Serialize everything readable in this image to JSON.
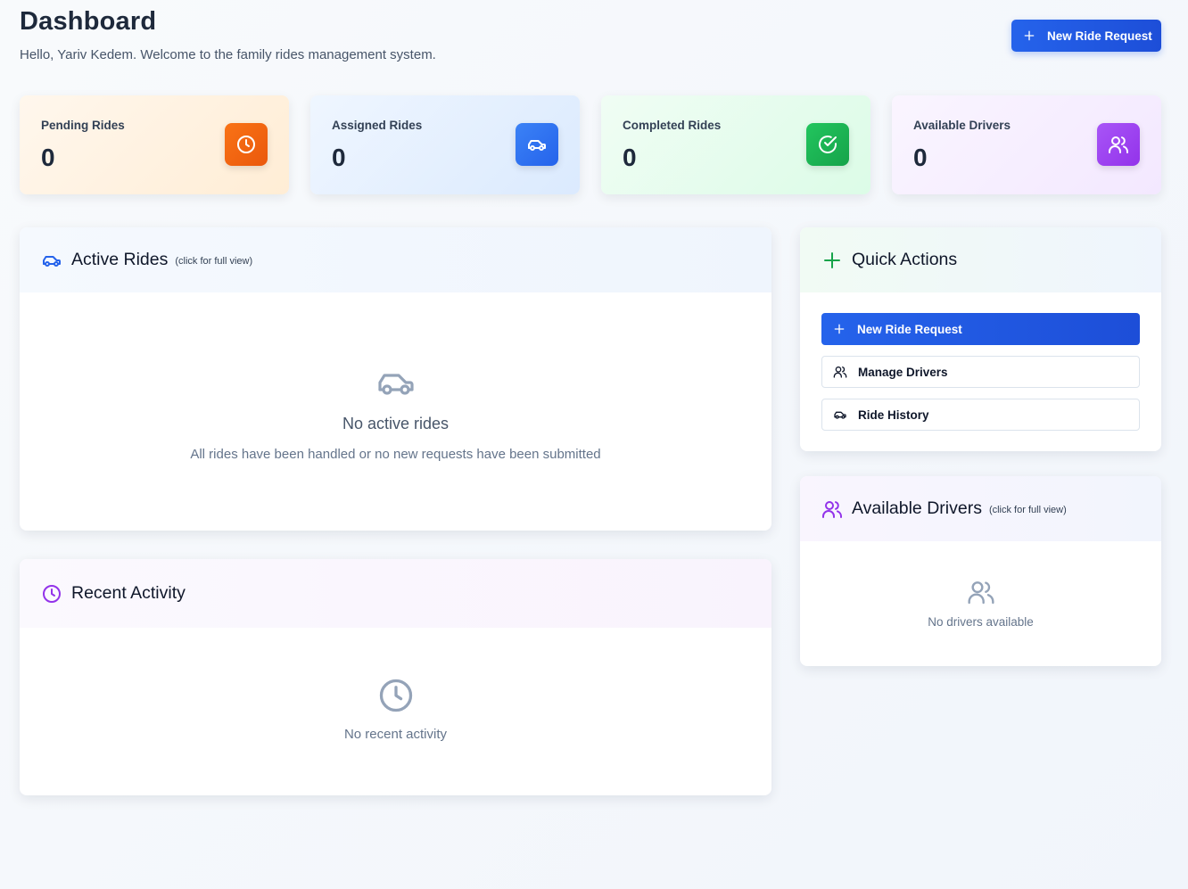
{
  "header": {
    "title": "Dashboard",
    "subtitle": "Hello, Yariv Kedem. Welcome to the family rides management system.",
    "new_ride_label": "New Ride Request"
  },
  "stats": [
    {
      "label": "Pending Rides",
      "value": "0",
      "icon": "clock-icon",
      "color": "#f97316"
    },
    {
      "label": "Assigned Rides",
      "value": "0",
      "icon": "car-icon",
      "color": "#2563eb"
    },
    {
      "label": "Completed Rides",
      "value": "0",
      "icon": "check-circle-icon",
      "color": "#16a34a"
    },
    {
      "label": "Available Drivers",
      "value": "0",
      "icon": "users-icon",
      "color": "#9333ea"
    }
  ],
  "active_rides": {
    "title": "Active Rides",
    "hint": "(click for full view)",
    "empty_title": "No active rides",
    "empty_text": "All rides have been handled or no new requests have been submitted"
  },
  "recent_activity": {
    "title": "Recent Activity",
    "empty_text": "No recent activity"
  },
  "quick_actions": {
    "title": "Quick Actions",
    "buttons": [
      {
        "label": "New Ride Request",
        "icon": "plus-icon"
      },
      {
        "label": "Manage Drivers",
        "icon": "users-icon"
      },
      {
        "label": "Ride History",
        "icon": "car-icon"
      }
    ]
  },
  "available_drivers": {
    "title": "Available Drivers",
    "hint": "(click for full view)",
    "empty_text": "No drivers available"
  },
  "colors": {
    "primary": "#2563eb",
    "orange": "#f97316",
    "green": "#16a34a",
    "purple": "#9333ea",
    "muted": "#94a3b8"
  }
}
